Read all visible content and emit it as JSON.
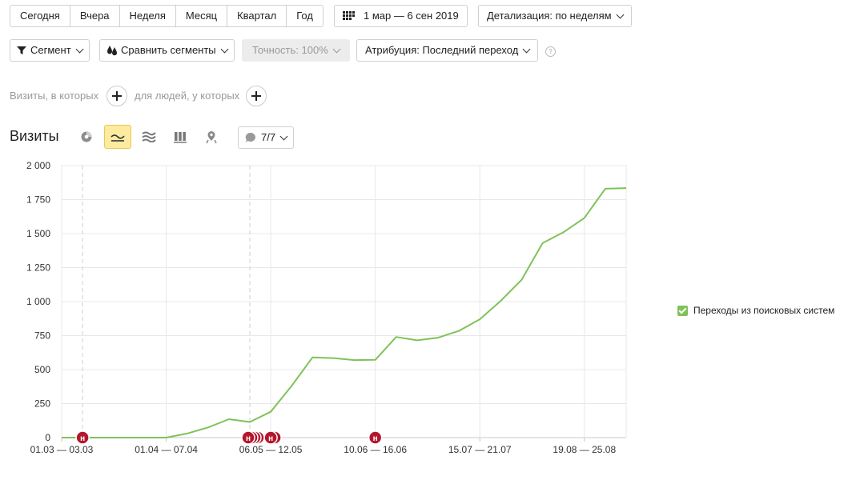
{
  "period": {
    "options": [
      "Сегодня",
      "Вчера",
      "Неделя",
      "Месяц",
      "Квартал",
      "Год"
    ]
  },
  "date_range": "1 мар — 6 сен 2019",
  "detail_label": "Детализация: по неделям",
  "toolbar": {
    "segment": "Сегмент",
    "compare": "Сравнить сегменты",
    "accuracy": "Точность: 100%",
    "attribution": "Атрибуция: Последний переход"
  },
  "filters": {
    "visits_label": "Визиты, в которых",
    "people_label": "для людей, у которых"
  },
  "report": {
    "title": "Визиты",
    "annotations_count": "7/7",
    "view_icons": [
      "pie-chart-icon",
      "line-chart-icon",
      "area-chart-icon",
      "bar-chart-icon",
      "map-icon"
    ],
    "active_view": "line-chart-icon"
  },
  "colors": {
    "series": "#7fc25a",
    "marker": "#b3172d",
    "accent_active": "#fdeba0"
  },
  "chart_data": {
    "type": "line",
    "title": "",
    "xlabel": "",
    "ylabel": "",
    "ylim": [
      0,
      2000
    ],
    "yticks": [
      0,
      250,
      500,
      750,
      1000,
      1250,
      1500,
      1750,
      2000
    ],
    "ytick_labels": [
      "0",
      "250",
      "500",
      "750",
      "1 000",
      "1 250",
      "1 500",
      "1 750",
      "2 000"
    ],
    "x_tick_labels": [
      "01.03 — 03.03",
      "01.04 — 07.04",
      "06.05 — 12.05",
      "10.06 — 16.06",
      "15.07 — 21.07",
      "19.08 — 25.08"
    ],
    "x_tick_index": [
      0,
      5,
      10,
      15,
      20,
      25
    ],
    "grid": true,
    "legend_position": "right",
    "series": [
      {
        "name": "Переходы из поисковых систем",
        "values": [
          0,
          0,
          0,
          0,
          0,
          0,
          30,
          75,
          135,
          115,
          190,
          380,
          590,
          585,
          570,
          572,
          740,
          715,
          735,
          785,
          870,
          1005,
          1160,
          1430,
          1510,
          1615,
          1830,
          1835
        ]
      }
    ],
    "annotation_markers": [
      {
        "index": 1,
        "label": "н"
      },
      {
        "index": 9,
        "label": "н"
      },
      {
        "index": 10,
        "label": "н"
      },
      {
        "index": 15,
        "label": "н"
      }
    ],
    "dashed_vlines_index": [
      1,
      9
    ]
  }
}
